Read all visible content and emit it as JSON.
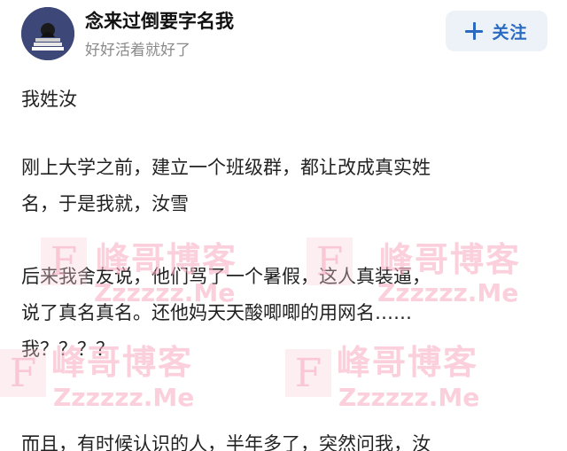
{
  "header": {
    "username": "念来过倒要字名我",
    "subtitle": "好好活着就好了",
    "follow_label": "关注"
  },
  "post": {
    "lines": [
      "我姓汝",
      "刚上大学之前，建立一个班级群，都让改成真实姓",
      "名，于是我就，汝雪",
      "后来我舍友说，他们骂了一个暑假，这人真装逼，",
      "说了真名真名。还他妈天天酸唧唧的用网名……",
      "我？？？？",
      "而且，有时候认识的人，半年多了，突然问我，汝"
    ]
  },
  "watermark": {
    "letter": "F",
    "title": "峰哥博客",
    "url": "Zzzzzz.Me"
  }
}
